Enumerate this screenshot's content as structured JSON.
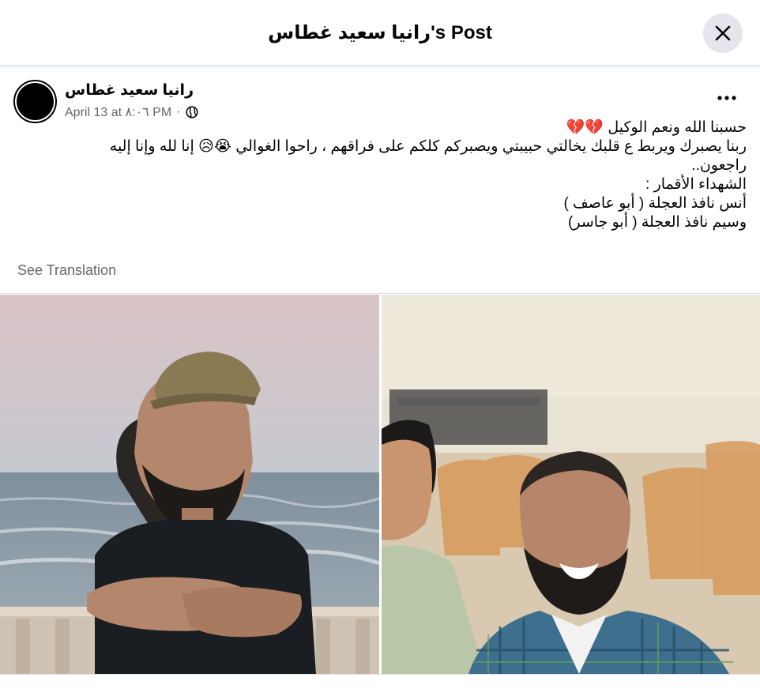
{
  "header": {
    "title": "رانيا سعيد غطاس's Post"
  },
  "post": {
    "author": "رانيا سعيد غطاس",
    "date": "April 13 at ٨:٠٦ PM",
    "separator": "·",
    "audience_icon": "globe-icon",
    "lines": [
      "حسبنا الله ونعم الوكيل 💔💔",
      "ربنا يصبرك ويربط ع قلبك يخالتي حبيبتي ويصبركم كلكم على فراقهم ، راحوا الغوالي 😭😥 إنا لله وإنا إليه راجعون..",
      "الشهداء الأقمار :",
      "أنس نافذ العجلة ( أبو عاصف )",
      "وسيم نافذ العجلة ( أبو جاسر)"
    ],
    "see_translation": "See Translation"
  },
  "icons": {
    "close": "close-icon",
    "more": "more-options-icon"
  },
  "colors": {
    "secondary_text": "#65676b",
    "divider": "#dcdfe3",
    "button_bg": "#e4e6eb"
  }
}
